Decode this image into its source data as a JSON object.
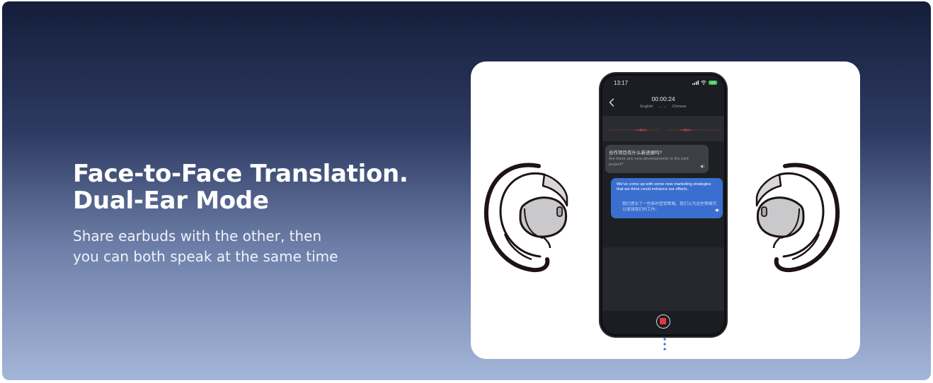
{
  "banner": {
    "headline": [
      "Face-to-Face Translation.",
      "Dual-Ear Mode"
    ],
    "subtitle": [
      "Share earbuds with the other, then",
      "you can both speak at the same time"
    ]
  },
  "phone": {
    "status_time": "13:17",
    "battery_label": "100",
    "timer": "00:00:24",
    "source_language": "English",
    "target_language": "Chinese",
    "swap_symbol": "←→",
    "bubble_left": {
      "chinese": "合作项目有什么新进展吗?",
      "english": "Are there any new developments in the joint project?"
    },
    "bubble_right": {
      "english": "We've come up with some new marketing strategies that we think could enhance our efforts.",
      "chinese": "我们提出了一些新的营销策略。我们认为这些策略可以增强我们的工作。"
    }
  },
  "colors": {
    "accent_blue": "#3a6fd0",
    "record_red": "#e5383b",
    "waveform_red": "#e24a4a",
    "battery_green": "#44c25a"
  },
  "icons": {
    "back": "chevron-left-icon",
    "speaker": "speaker-icon",
    "record": "stop-record-icon"
  }
}
